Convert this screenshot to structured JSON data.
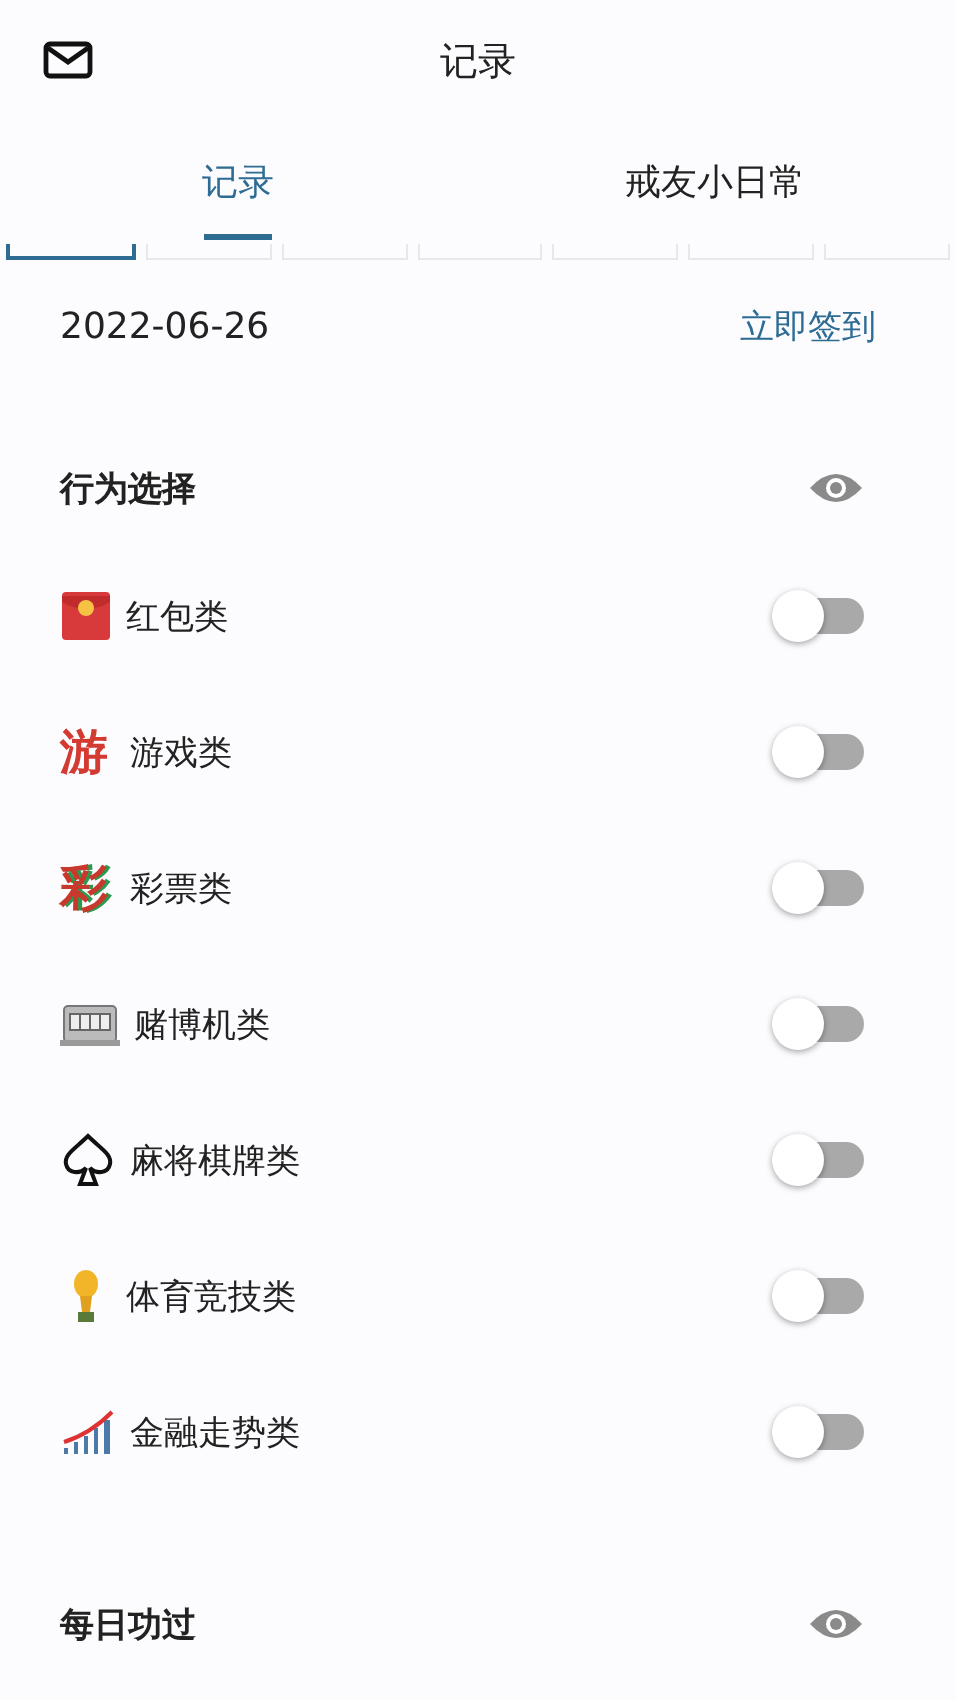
{
  "header": {
    "title": "记录"
  },
  "tabs": [
    {
      "label": "记录",
      "selected": true
    },
    {
      "label": "戒友小日常",
      "selected": false
    }
  ],
  "week_strip": [
    {
      "selected": true
    },
    {
      "selected": false
    },
    {
      "selected": false
    },
    {
      "selected": false
    },
    {
      "selected": false
    },
    {
      "selected": false
    },
    {
      "selected": false
    }
  ],
  "date": "2022-06-26",
  "checkin_link": "立即签到",
  "sections": [
    {
      "title": "行为选择",
      "items": [
        {
          "kind": "envelope",
          "label": "红包类",
          "on": false
        },
        {
          "kind": "glyph",
          "icon_text": "游",
          "label": "游戏类",
          "on": false
        },
        {
          "kind": "glyph",
          "icon_text": "彩",
          "label": "彩票类",
          "on": false
        },
        {
          "kind": "slot",
          "label": "赌博机类",
          "on": false
        },
        {
          "kind": "spade",
          "label": "麻将棋牌类",
          "on": false
        },
        {
          "kind": "trophy",
          "label": "体育竞技类",
          "on": false
        },
        {
          "kind": "chart",
          "label": "金融走势类",
          "on": false
        }
      ]
    },
    {
      "title": "每日功过"
    }
  ]
}
